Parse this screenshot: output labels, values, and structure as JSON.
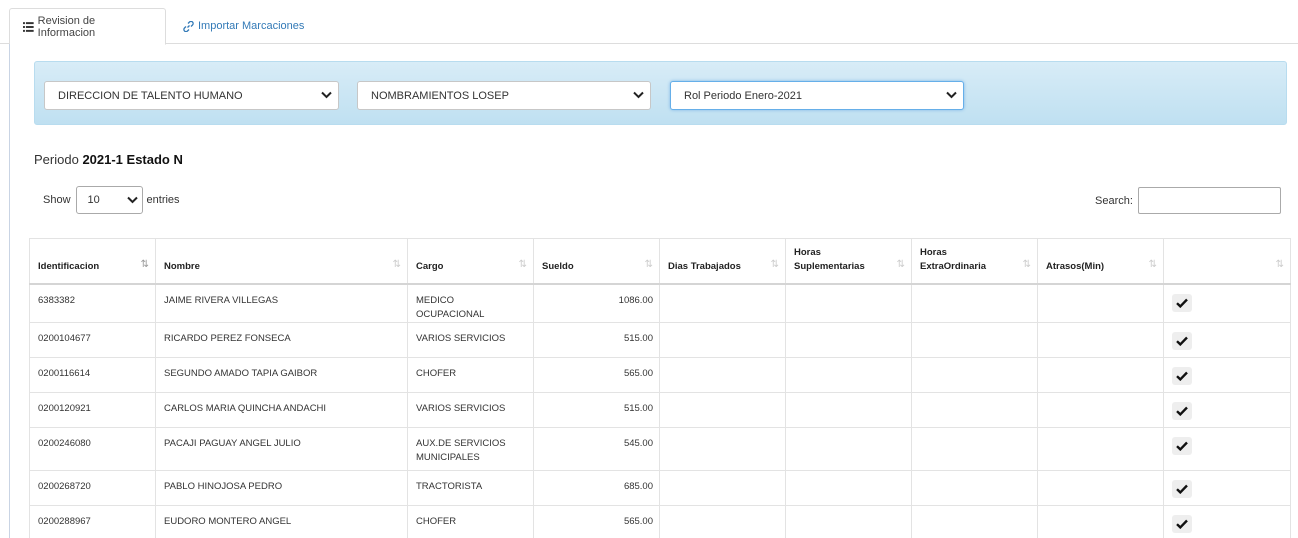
{
  "tabs": {
    "revision_label": "Revision de Informacion",
    "importar_label": "Importar Marcaciones"
  },
  "filters": {
    "department": "DIRECCION DE TALENTO HUMANO",
    "contract_type": "NOMBRAMIENTOS LOSEP",
    "period": "Rol Periodo Enero-2021"
  },
  "periodo": {
    "label": "Periodo",
    "value": "2021-1 Estado N"
  },
  "length_control": {
    "show_label": "Show",
    "value": "10",
    "entries_label": "entries"
  },
  "search": {
    "label": "Search:",
    "value": ""
  },
  "table": {
    "columns": [
      {
        "line1": "",
        "line2": "Identificacion"
      },
      {
        "line1": "",
        "line2": "Nombre"
      },
      {
        "line1": "",
        "line2": "Cargo"
      },
      {
        "line1": "",
        "line2": "Sueldo"
      },
      {
        "line1": "",
        "line2": "Dias Trabajados"
      },
      {
        "line1": "Horas",
        "line2": "Suplementarias"
      },
      {
        "line1": "Horas",
        "line2": "ExtraOrdinaria"
      },
      {
        "line1": "",
        "line2": "Atrasos(Min)"
      },
      {
        "line1": "",
        "line2": ""
      }
    ],
    "rows": [
      {
        "id": "6383382",
        "nombre": "JAIME RIVERA VILLEGAS",
        "cargo1": "MEDICO OCUPACIONAL",
        "cargo2": "",
        "sueldo": "1086.00",
        "dias": "",
        "hsup": "",
        "hext": "",
        "atrasos": ""
      },
      {
        "id": "0200104677",
        "nombre": "RICARDO PEREZ FONSECA",
        "cargo1": "VARIOS SERVICIOS",
        "cargo2": "",
        "sueldo": "515.00",
        "dias": "",
        "hsup": "",
        "hext": "",
        "atrasos": ""
      },
      {
        "id": "0200116614",
        "nombre": "SEGUNDO AMADO TAPIA GAIBOR",
        "cargo1": "CHOFER",
        "cargo2": "",
        "sueldo": "565.00",
        "dias": "",
        "hsup": "",
        "hext": "",
        "atrasos": ""
      },
      {
        "id": "0200120921",
        "nombre": "CARLOS MARIA QUINCHA ANDACHI",
        "cargo1": "VARIOS SERVICIOS",
        "cargo2": "",
        "sueldo": "515.00",
        "dias": "",
        "hsup": "",
        "hext": "",
        "atrasos": ""
      },
      {
        "id": "0200246080",
        "nombre": "PACAJI PAGUAY ANGEL JULIO",
        "cargo1": "AUX.DE SERVICIOS",
        "cargo2": "MUNICIPALES",
        "sueldo": "545.00",
        "dias": "",
        "hsup": "",
        "hext": "",
        "atrasos": ""
      },
      {
        "id": "0200268720",
        "nombre": "PABLO HINOJOSA PEDRO",
        "cargo1": "TRACTORISTA",
        "cargo2": "",
        "sueldo": "685.00",
        "dias": "",
        "hsup": "",
        "hext": "",
        "atrasos": ""
      },
      {
        "id": "0200288967",
        "nombre": "EUDORO MONTERO ANGEL",
        "cargo1": "CHOFER",
        "cargo2": "",
        "sueldo": "565.00",
        "dias": "",
        "hsup": "",
        "hext": "",
        "atrasos": ""
      }
    ]
  },
  "icons": {
    "tab_revision": "list-icon",
    "tab_importar": "link-icon",
    "select": "chevron-down-icon",
    "sort": "sort-icon",
    "row_action": "check-icon"
  },
  "colors": {
    "filter_panel": "#c8e6f5",
    "link": "#337ab7",
    "focus": "#66afe9"
  }
}
